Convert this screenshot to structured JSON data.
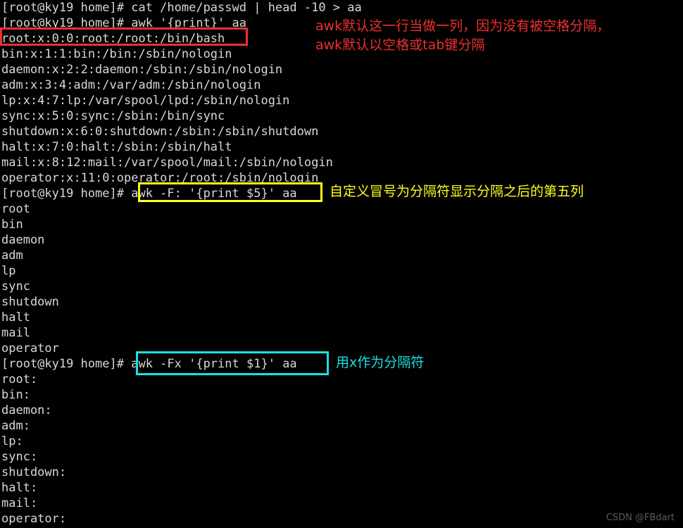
{
  "terminal": {
    "background_color": "#000000",
    "text_color": "#d8d8d8",
    "lines": [
      "[root@ky19 home]# cat /home/passwd | head -10 > aa",
      "[root@ky19 home]# awk '{print}' aa",
      "root:x:0:0:root:/root:/bin/bash",
      "bin:x:1:1:bin:/bin:/sbin/nologin",
      "daemon:x:2:2:daemon:/sbin:/sbin/nologin",
      "adm:x:3:4:adm:/var/adm:/sbin/nologin",
      "lp:x:4:7:lp:/var/spool/lpd:/sbin/nologin",
      "sync:x:5:0:sync:/sbin:/bin/sync",
      "shutdown:x:6:0:shutdown:/sbin:/sbin/shutdown",
      "halt:x:7:0:halt:/sbin:/sbin/halt",
      "mail:x:8:12:mail:/var/spool/mail:/sbin/nologin",
      "operator:x:11:0:operator:/root:/sbin/nologin",
      "[root@ky19 home]# awk -F: '{print $5}' aa",
      "root",
      "bin",
      "daemon",
      "adm",
      "lp",
      "sync",
      "shutdown",
      "halt",
      "mail",
      "operator",
      "[root@ky19 home]# awk -Fx '{print $1}' aa",
      "root:",
      "bin:",
      "daemon:",
      "adm:",
      "lp:",
      "sync:",
      "shutdown:",
      "halt:",
      "mail:",
      "operator:"
    ]
  },
  "annotations": {
    "red_box": {
      "highlighted_text": "root:x:0:0:root:/root:/bin/bash",
      "color": "#f03030"
    },
    "red_note": {
      "line1": "awk默认这一行当做一列，因为没有被空格分隔，",
      "line2": "awk默认以空格或tab键分隔",
      "color": "#f03030"
    },
    "yellow_box": {
      "highlighted_text": "awk -F: '{print $5}' aa",
      "color": "#ffff1a"
    },
    "yellow_note": {
      "text": "自定义冒号为分隔符显示分隔之后的第五列",
      "color": "#ffff1a"
    },
    "cyan_box": {
      "highlighted_text": "awk -Fx '{print $1}' aa",
      "color": "#1ae0e0"
    },
    "cyan_note": {
      "text": "用x作为分隔符",
      "color": "#1ae0e0"
    }
  },
  "watermark": {
    "text": "CSDN @FBdart"
  }
}
